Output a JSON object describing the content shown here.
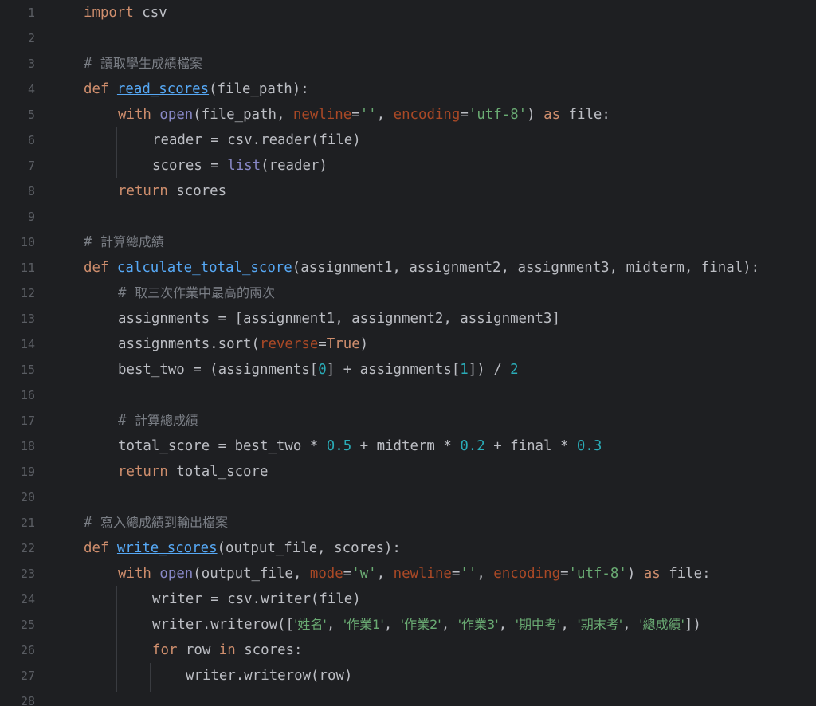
{
  "line_numbers": [
    "1",
    "2",
    "3",
    "4",
    "5",
    "6",
    "7",
    "8",
    "9",
    "10",
    "11",
    "12",
    "13",
    "14",
    "15",
    "16",
    "17",
    "18",
    "19",
    "20",
    "21",
    "22",
    "23",
    "24",
    "25",
    "26",
    "27",
    "28"
  ],
  "code": {
    "l1": {
      "kw": "import",
      "rest": " csv"
    },
    "l3": {
      "hash": "# ",
      "text": "讀取學生成績檔案"
    },
    "l4": {
      "kw": "def",
      "fn": "read_scores",
      "rest": "(file_path):"
    },
    "l5": {
      "kw_with": "with",
      "bi_open": "open",
      "a": "(file_path, ",
      "p_newline": "newline",
      "b": "=",
      "s_empty": "''",
      "c": ", ",
      "p_encoding": "encoding",
      "d": "=",
      "s_utf8": "'utf-8'",
      "e": ") ",
      "kw_as": "as",
      "f": " file:"
    },
    "l6": {
      "text": "reader = csv.reader(file)"
    },
    "l7": {
      "a": "scores = ",
      "bi_list": "list",
      "b": "(reader)"
    },
    "l8": {
      "kw": "return",
      "rest": " scores"
    },
    "l10": {
      "hash": "# ",
      "text": "計算總成績"
    },
    "l11": {
      "kw": "def",
      "fn": "calculate_total_score",
      "rest": "(assignment1, assignment2, assignment3, midterm, final):"
    },
    "l12": {
      "hash": "# ",
      "text": "取三次作業中最高的兩次"
    },
    "l13": {
      "text": "assignments = [assignment1, assignment2, assignment3]"
    },
    "l14": {
      "a": "assignments.sort(",
      "p_reverse": "reverse",
      "b": "=",
      "kw_true": "True",
      "c": ")"
    },
    "l15": {
      "a": "best_two = (assignments[",
      "n0": "0",
      "b": "] + assignments[",
      "n1": "1",
      "c": "]) / ",
      "n2": "2"
    },
    "l17": {
      "hash": "# ",
      "text": "計算總成績"
    },
    "l18": {
      "a": "total_score = best_two * ",
      "n05": "0.5",
      "b": " + midterm * ",
      "n02": "0.2",
      "c": " + final * ",
      "n03": "0.3"
    },
    "l19": {
      "kw": "return",
      "rest": " total_score"
    },
    "l21": {
      "hash": "# ",
      "text": "寫入總成績到輸出檔案"
    },
    "l22": {
      "kw": "def",
      "fn": "write_scores",
      "rest": "(output_file, scores):"
    },
    "l23": {
      "kw_with": "with",
      "bi_open": "open",
      "a": "(output_file, ",
      "p_mode": "mode",
      "b": "=",
      "s_w": "'w'",
      "c": ", ",
      "p_newline": "newline",
      "d": "=",
      "s_empty": "''",
      "e": ", ",
      "p_encoding": "encoding",
      "f": "=",
      "s_utf8": "'utf-8'",
      "g": ") ",
      "kw_as": "as",
      "h": " file:"
    },
    "l24": {
      "text": "writer = csv.writer(file)"
    },
    "l25": {
      "a": "writer.writerow([",
      "s1": "'姓名'",
      "s2": "'作業1'",
      "s3": "'作業2'",
      "s4": "'作業3'",
      "s5": "'期中考'",
      "s6": "'期末考'",
      "s7": "'總成績'",
      "sep": ", ",
      "z": "])"
    },
    "l26": {
      "kw_for": "for",
      "a": " row ",
      "kw_in": "in",
      "b": " scores:"
    },
    "l27": {
      "text": "writer.writerow(row)"
    }
  },
  "colors": {
    "background": "#1e1f22",
    "keyword": "#cf8e6d",
    "function": "#56a8f5",
    "builtin": "#8888c6",
    "comment": "#7a7e85",
    "string": "#6aab73",
    "number": "#2aacb8",
    "parameter": "#aa4926",
    "text": "#bcbec4",
    "line_number": "#5a5d63"
  }
}
